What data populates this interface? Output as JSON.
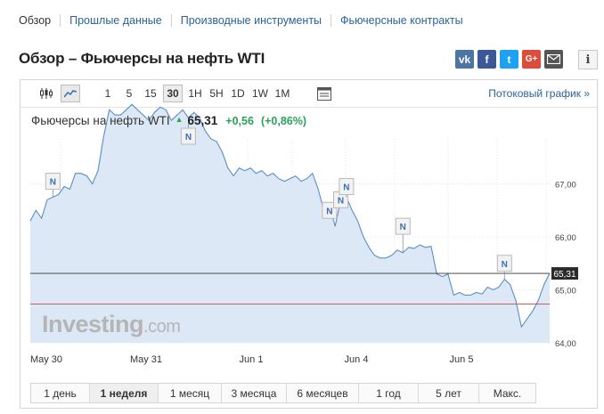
{
  "subnav": {
    "items": [
      "Обзор",
      "Прошлые данные",
      "Производные инструменты",
      "Фьючерсные контракты"
    ]
  },
  "page": {
    "title": "Обзор – Фьючерсы на нефть WTI"
  },
  "social": {
    "icons": [
      "vk-icon",
      "facebook-icon",
      "twitter-icon",
      "google-plus-icon",
      "mail-icon"
    ],
    "labels": {
      "vk": "vk",
      "fb": "f",
      "tw": "t",
      "gp": "G+"
    },
    "info_label": "i"
  },
  "toolbar": {
    "timeframes": [
      "1",
      "5",
      "15",
      "30",
      "1H",
      "5H",
      "1D",
      "1W",
      "1M"
    ],
    "active_timeframe": "30",
    "stream_link": "Потоковый график »"
  },
  "quote": {
    "name": "Фьючерсы на нефть WTI",
    "price": "65,31",
    "change": "+0,56",
    "change_pct": "(+0,86%)"
  },
  "ranges": {
    "items": [
      "1 день",
      "1 неделя",
      "1 месяц",
      "3 месяца",
      "6 месяцев",
      "1 год",
      "5 лет",
      "Макс."
    ],
    "active": "1 неделя"
  },
  "colors": {
    "line": "#5b8ec7",
    "area": "#dce8f5",
    "current_line": "#333333",
    "reference_line": "#c44a4a",
    "up": "#2aa35a",
    "link": "#2a6496"
  },
  "chart_data": {
    "type": "area",
    "x_tick_labels": [
      "May 30",
      "May 31",
      "Jun 1",
      "Jun 4",
      "Jun 5"
    ],
    "y_tick_labels": [
      "67,00",
      "66,00",
      "65,00",
      "64,00"
    ],
    "ylim": [
      64.0,
      67.85
    ],
    "current_price_label": "65,31",
    "current_price": 65.31,
    "reference_price": 64.73,
    "watermark": "Investing.com",
    "news_marker_label": "N",
    "news_markers": [
      {
        "i": 4,
        "value": 67.05
      },
      {
        "i": 28,
        "value": 67.9
      },
      {
        "i": 53,
        "value": 66.5
      },
      {
        "i": 55,
        "value": 66.7
      },
      {
        "i": 56,
        "value": 66.95
      },
      {
        "i": 66,
        "value": 66.2
      },
      {
        "i": 84,
        "value": 65.5
      }
    ],
    "series": [
      {
        "values": [
          66.3,
          66.5,
          66.35,
          66.7,
          66.75,
          66.8,
          66.95,
          66.9,
          67.2,
          67.2,
          67.15,
          67.0,
          67.25,
          67.9,
          68.4,
          68.3,
          68.3,
          68.4,
          68.5,
          68.4,
          68.3,
          68.2,
          68.35,
          68.45,
          68.4,
          68.2,
          68.3,
          68.4,
          68.25,
          68.35,
          68.25,
          68.0,
          67.85,
          67.8,
          67.6,
          67.3,
          67.15,
          67.3,
          67.25,
          67.3,
          67.2,
          67.25,
          67.15,
          67.2,
          67.1,
          67.05,
          67.1,
          67.15,
          67.05,
          67.1,
          67.2,
          66.9,
          66.5,
          66.6,
          66.2,
          66.7,
          66.75,
          66.5,
          66.3,
          66.0,
          65.8,
          65.65,
          65.6,
          65.6,
          65.65,
          65.75,
          65.7,
          65.8,
          65.78,
          65.85,
          65.8,
          65.82,
          65.3,
          65.25,
          65.3,
          64.9,
          64.95,
          64.9,
          64.9,
          64.95,
          64.92,
          65.05,
          65.0,
          65.05,
          65.2,
          65.1,
          64.8,
          64.3,
          64.45,
          64.6,
          64.8,
          65.1,
          65.31
        ]
      }
    ]
  }
}
